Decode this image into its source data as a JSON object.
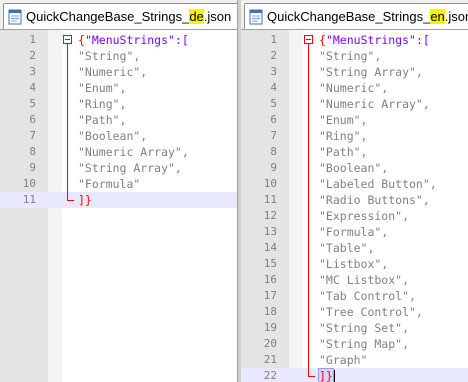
{
  "left": {
    "tab": {
      "prefix": "QuickChangeBase_Strings_",
      "lang": "de",
      "suffix": ".json"
    },
    "lines": [
      {
        "n": "1",
        "text": "\"MenuStrings\":[",
        "kind": "open"
      },
      {
        "n": "2",
        "text": "\"String\","
      },
      {
        "n": "3",
        "text": "\"Numeric\","
      },
      {
        "n": "4",
        "text": "\"Enum\","
      },
      {
        "n": "5",
        "text": "\"Ring\","
      },
      {
        "n": "6",
        "text": "\"Path\","
      },
      {
        "n": "7",
        "text": "\"Boolean\","
      },
      {
        "n": "8",
        "text": "\"Numeric Array\","
      },
      {
        "n": "9",
        "text": "\"String Array\","
      },
      {
        "n": "10",
        "text": "\"Formula\""
      },
      {
        "n": "11",
        "text": "]}",
        "kind": "close"
      }
    ]
  },
  "right": {
    "tab": {
      "prefix": "QuickChangeBase_Strings_",
      "lang": "en",
      "suffix": ".json"
    },
    "lines": [
      {
        "n": "1",
        "text": "\"MenuStrings\":[",
        "kind": "open"
      },
      {
        "n": "2",
        "text": "\"String\","
      },
      {
        "n": "3",
        "text": "\"String Array\","
      },
      {
        "n": "4",
        "text": "\"Numeric\","
      },
      {
        "n": "5",
        "text": "\"Numeric Array\","
      },
      {
        "n": "6",
        "text": "\"Enum\","
      },
      {
        "n": "7",
        "text": "\"Ring\","
      },
      {
        "n": "8",
        "text": "\"Path\","
      },
      {
        "n": "9",
        "text": "\"Boolean\","
      },
      {
        "n": "10",
        "text": "\"Labeled Button\","
      },
      {
        "n": "11",
        "text": "\"Radio Buttons\","
      },
      {
        "n": "12",
        "text": "\"Expression\","
      },
      {
        "n": "13",
        "text": "\"Formula\","
      },
      {
        "n": "14",
        "text": "\"Table\","
      },
      {
        "n": "15",
        "text": "\"Listbox\","
      },
      {
        "n": "16",
        "text": "\"MC Listbox\","
      },
      {
        "n": "17",
        "text": "\"Tab Control\","
      },
      {
        "n": "18",
        "text": "\"Tree Control\","
      },
      {
        "n": "19",
        "text": "\"String Set\","
      },
      {
        "n": "20",
        "text": "\"String Map\","
      },
      {
        "n": "21",
        "text": "\"Graph\""
      },
      {
        "n": "22",
        "text": "]}",
        "kind": "close"
      }
    ]
  },
  "colors": {
    "key": "#8000ff",
    "brace": "#ff0000",
    "text": "#808080",
    "highlight": "#fff200",
    "current_line": "#e8e8ff"
  },
  "icons": {
    "tab_file": "notepad-file-icon",
    "fold": "fold-minus-icon"
  }
}
